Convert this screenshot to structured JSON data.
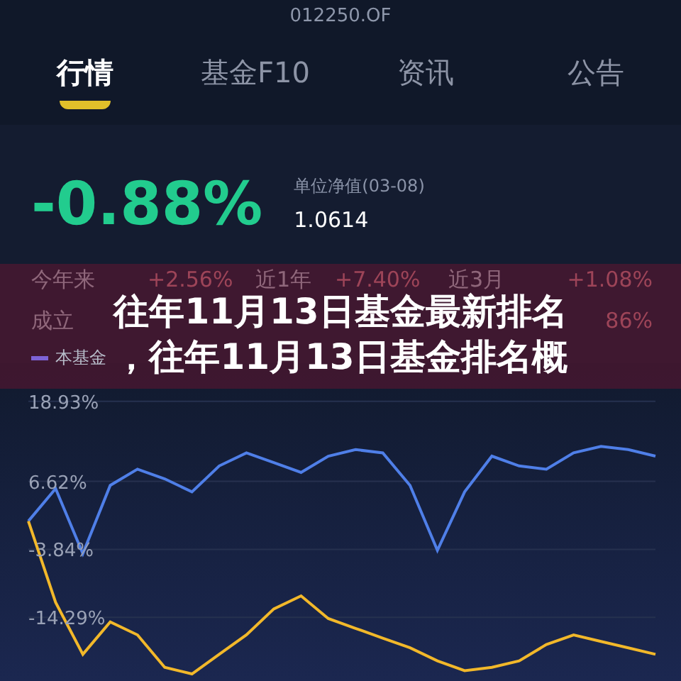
{
  "header": {
    "code": "012250.OF"
  },
  "tabs": [
    {
      "label": "行情",
      "selected": true
    },
    {
      "label": "基金F10",
      "selected": false
    },
    {
      "label": "资讯",
      "selected": false
    },
    {
      "label": "公告",
      "selected": false
    }
  ],
  "summary": {
    "change": "-0.88%",
    "nav_label": "单位净值(03-08)",
    "nav": "1.0614",
    "stats": [
      {
        "label": "今年来",
        "value": "+2.56%"
      },
      {
        "label": "近1年",
        "value": "+7.40%"
      },
      {
        "label": "近3月",
        "value": "+1.08%"
      },
      {
        "label": "成立",
        "value": "86%"
      }
    ],
    "legend": [
      {
        "label": "本基金",
        "color": "#7d63d6"
      }
    ]
  },
  "chart": {
    "chart_data": {
      "type": "line",
      "grid": true,
      "ylim": [
        -24.1,
        24.8
      ],
      "yticks": [
        {
          "value": 18.93,
          "label": "18.93%"
        },
        {
          "value": 6.62,
          "label": "6.62%"
        },
        {
          "value": -3.84,
          "label": "-3.84%"
        },
        {
          "value": -14.29,
          "label": "-14.29%"
        }
      ],
      "series": [
        {
          "color": "#4f7fe8",
          "values": [
            0.5,
            5.5,
            -4.5,
            6,
            8.5,
            7,
            5,
            9,
            11,
            9.5,
            8,
            10.5,
            11.5,
            11,
            6,
            -4,
            5,
            10.5,
            9,
            8.5,
            11,
            12,
            11.5,
            10.5
          ]
        },
        {
          "color": "#f2b82a",
          "values": [
            0.5,
            -12,
            -20,
            -15,
            -17,
            -22,
            -23,
            -20,
            -17,
            -13,
            -11,
            -14.5,
            -16,
            -17.5,
            -19,
            -21,
            -22.5,
            -22,
            -21,
            -18.5,
            -17,
            -18,
            -19,
            -20
          ]
        }
      ]
    }
  },
  "overlay": {
    "lines": [
      "往年11月13日基金最新排名",
      "，往年11月13日基金排名概"
    ]
  }
}
